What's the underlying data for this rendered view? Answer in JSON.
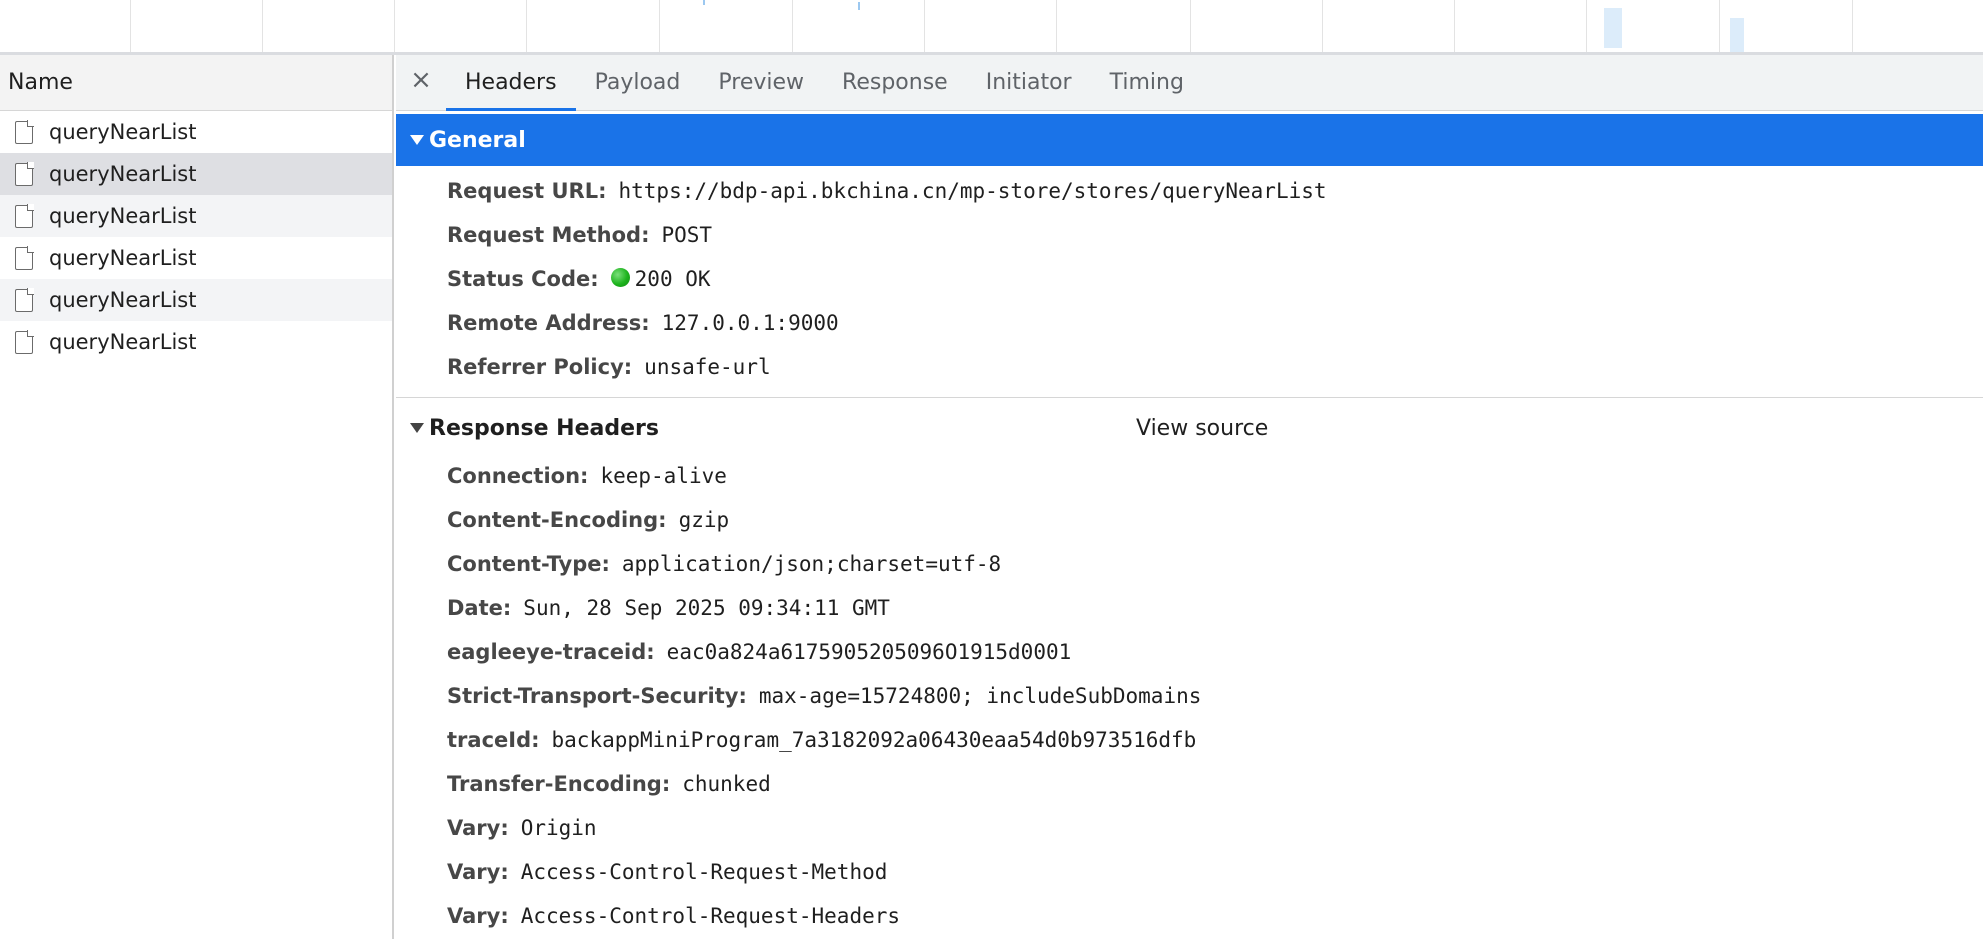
{
  "request_list": {
    "header": "Name",
    "rows": [
      {
        "name": "queryNearList"
      },
      {
        "name": "queryNearList"
      },
      {
        "name": "queryNearList"
      },
      {
        "name": "queryNearList"
      },
      {
        "name": "queryNearList"
      },
      {
        "name": "queryNearList"
      }
    ],
    "selected_index": 1
  },
  "tabs": {
    "close_glyph": "×",
    "items": [
      "Headers",
      "Payload",
      "Preview",
      "Response",
      "Initiator",
      "Timing"
    ],
    "active": "Headers"
  },
  "general": {
    "title": "General",
    "fields": [
      {
        "key": "Request URL:",
        "value": "https://bdp-api.bkchina.cn/mp-store/stores/queryNearList"
      },
      {
        "key": "Request Method:",
        "value": "POST"
      },
      {
        "key": "Status Code:",
        "value": "200 OK"
      },
      {
        "key": "Remote Address:",
        "value": "127.0.0.1:9000"
      },
      {
        "key": "Referrer Policy:",
        "value": "unsafe-url"
      }
    ]
  },
  "response_headers": {
    "title": "Response Headers",
    "view_source": "View source",
    "fields": [
      {
        "key": "Connection:",
        "value": "keep-alive"
      },
      {
        "key": "Content-Encoding:",
        "value": "gzip"
      },
      {
        "key": "Content-Type:",
        "value": "application/json;charset=utf-8"
      },
      {
        "key": "Date:",
        "value": "Sun, 28 Sep 2025 09:34:11 GMT"
      },
      {
        "key": "eagleeye-traceid:",
        "value": "eac0a824a6175905205096O1915d0001"
      },
      {
        "key": "Strict-Transport-Security:",
        "value": "max-age=15724800; includeSubDomains"
      },
      {
        "key": "traceId:",
        "value": "backappMiniProgram_7a3182092a06430eaa54d0b973516dfb"
      },
      {
        "key": "Transfer-Encoding:",
        "value": "chunked"
      },
      {
        "key": "Vary:",
        "value": "Origin"
      },
      {
        "key": "Vary:",
        "value": "Access-Control-Request-Method"
      },
      {
        "key": "Vary:",
        "value": "Access-Control-Request-Headers"
      }
    ]
  },
  "colors": {
    "accent": "#1a73e8",
    "status_ok": "#1db31d"
  },
  "icons": {
    "request_row": "document-icon",
    "status": "status-ok-dot-icon",
    "collapse": "caret-down-icon",
    "close": "close-icon"
  }
}
